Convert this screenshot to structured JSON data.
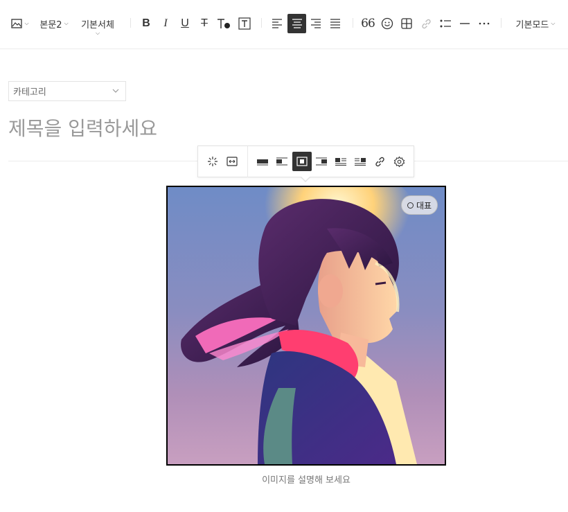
{
  "toolbar": {
    "paragraph_style": "본문2",
    "font_family": "기본서체",
    "mode": "기본모드"
  },
  "category": {
    "label": "카테고리"
  },
  "title": {
    "placeholder": "제목을 입력하세요"
  },
  "image": {
    "representative_label": "대표",
    "caption_placeholder": "이미지를 설명해 보세요"
  },
  "colors": {
    "active_bg": "#333333",
    "border": "#e2e2e2",
    "placeholder": "#999999"
  }
}
